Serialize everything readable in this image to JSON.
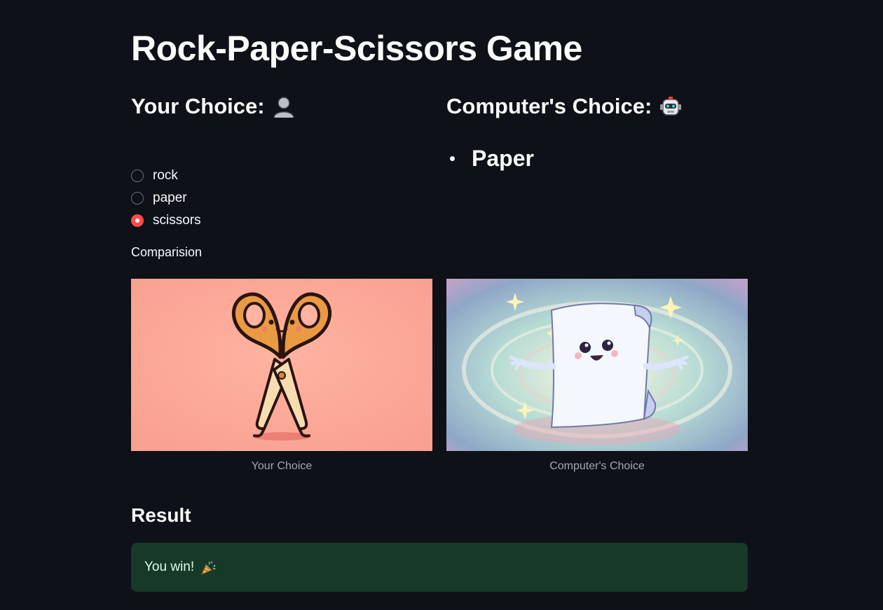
{
  "title": "Rock-Paper-Scissors Game",
  "user": {
    "heading": "Your Choice:",
    "heading_icon": "person-silhouette-icon",
    "options": [
      "rock",
      "paper",
      "scissors"
    ],
    "selected": "scissors"
  },
  "computer": {
    "heading": "Computer's Choice:",
    "heading_icon": "robot-face-icon",
    "choice": "Paper"
  },
  "comparison_label": "Comparision",
  "images": {
    "user_caption": "Your Choice",
    "computer_caption": "Computer's Choice",
    "user_image": "scissors-character-image",
    "computer_image": "paper-character-image"
  },
  "result": {
    "heading": "Result",
    "message": "You win!",
    "message_icon": "party-popper-icon"
  },
  "colors": {
    "background": "#0e1117",
    "accent": "#ff4b4b",
    "success_bg": "#173928",
    "success_text": "#dffde9"
  }
}
